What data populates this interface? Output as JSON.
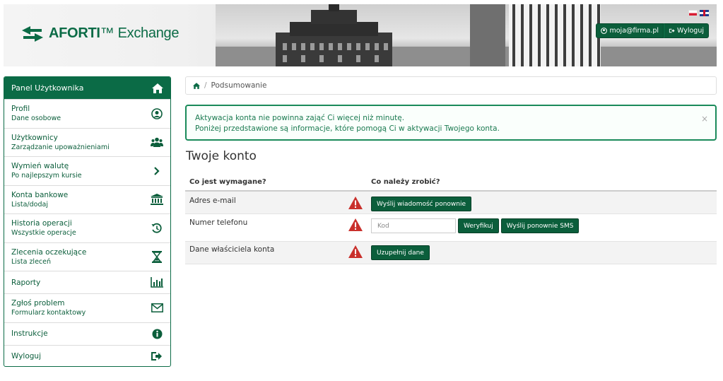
{
  "header": {
    "logo_text_bold": "AFORTI",
    "logo_text_rest": "Exchange",
    "user_email": "moja@firma.pl",
    "logout_label": "Wyloguj",
    "flags": [
      "pl-flag-icon",
      "en-flag-icon"
    ]
  },
  "sidebar": {
    "title": "Panel Użytkownika",
    "items": [
      {
        "label": "Profil",
        "sub": "Dane osobowe",
        "icon": "user-circle-icon"
      },
      {
        "label": "Użytkownicy",
        "sub": "Zarządzanie upoważnieniami",
        "icon": "users-icon"
      },
      {
        "label": "Wymień walutę",
        "sub": "Po najlepszym kursie",
        "icon": "chevron-right-icon"
      },
      {
        "label": "Konta bankowe",
        "sub": "Lista/dodaj",
        "icon": "bank-icon"
      },
      {
        "label": "Historia operacji",
        "sub": "Wszystkie operacje",
        "icon": "history-icon"
      },
      {
        "label": "Zlecenia oczekujące",
        "sub": "Lista zleceń",
        "icon": "hourglass-icon"
      },
      {
        "label": "Raporty",
        "sub": "",
        "icon": "bar-chart-icon"
      },
      {
        "label": "Zgłoś problem",
        "sub": "Formularz kontaktowy",
        "icon": "envelope-icon"
      },
      {
        "label": "Instrukcje",
        "sub": "",
        "icon": "info-icon"
      },
      {
        "label": "Wyloguj",
        "sub": "",
        "icon": "sign-out-icon"
      }
    ]
  },
  "breadcrumb": {
    "current": "Podsumowanie"
  },
  "alert": {
    "line1": "Aktywacja konta nie powinna zająć Ci więcej niż minutę.",
    "line2": "Poniżej przedstawione są informacje, które pomogą Ci w aktywacji Twojego konta.",
    "close": "×"
  },
  "page_title": "Twoje konto",
  "table": {
    "col_required": "Co jest wymagane?",
    "col_action": "Co należy zrobić?",
    "rows": [
      {
        "label": "Adres e-mail",
        "button": "Wyślij wiadomość ponownie"
      },
      {
        "label": "Numer telefonu",
        "input_placeholder": "Kod",
        "verify": "Weryfikuj",
        "resend_sms": "Wyślij ponownie SMS"
      },
      {
        "label": "Dane właściciela konta",
        "button": "Uzupełnij dane"
      }
    ]
  },
  "colors": {
    "brand": "#0b6b46",
    "button": "#0b5e3b",
    "warning": "#c9302c"
  }
}
